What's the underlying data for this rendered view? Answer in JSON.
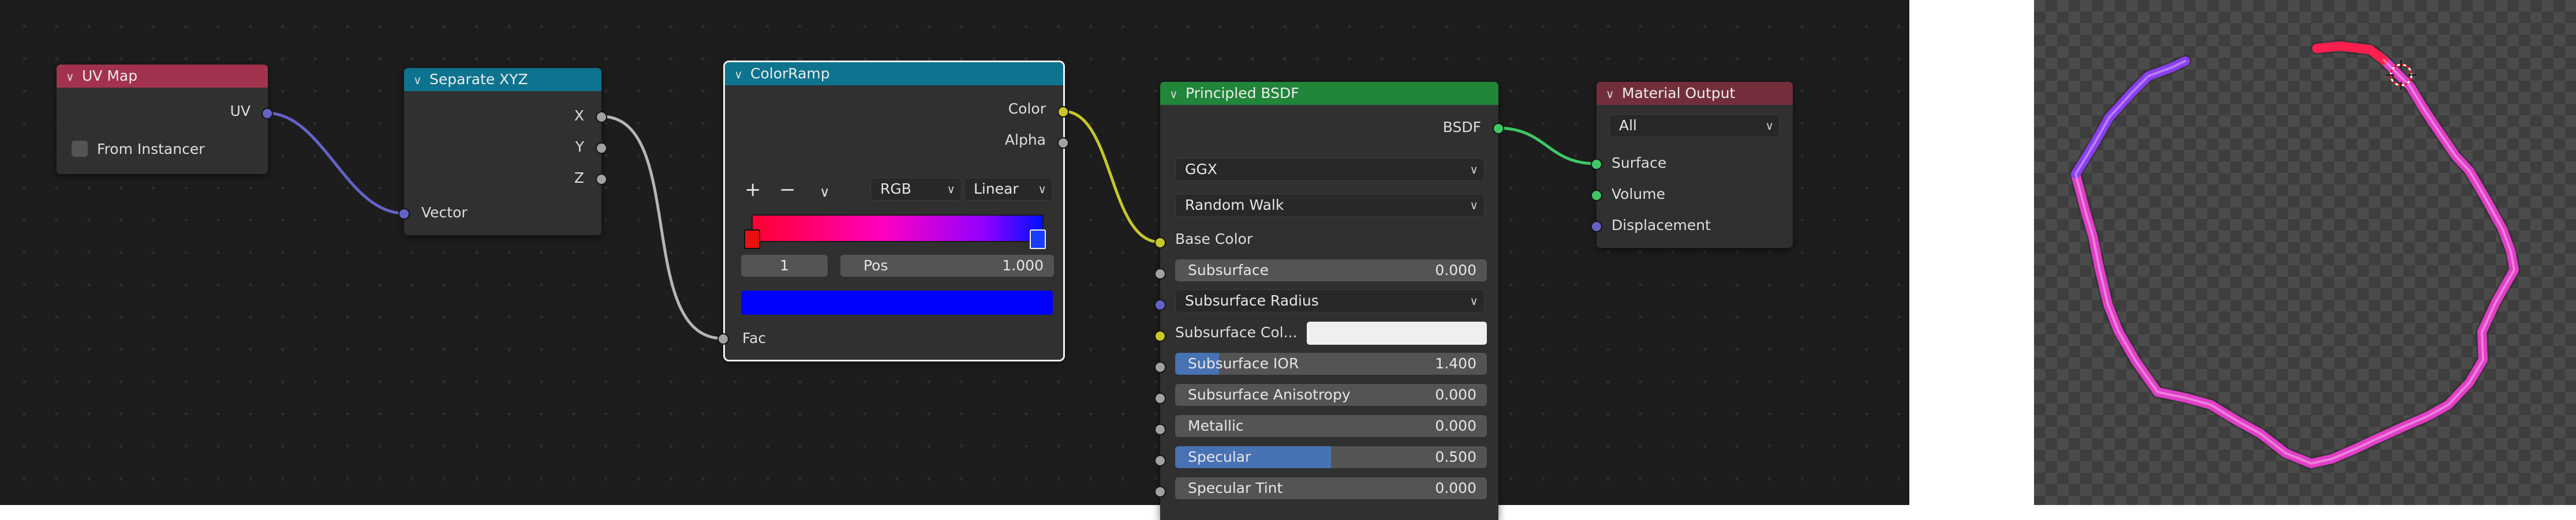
{
  "colors": {
    "uvmap_header": "#a3324f",
    "separate_header": "#0d738e",
    "colorramp_header": "#0d738e",
    "bsdf_header": "#21853a",
    "output_header": "#722f3b",
    "socket_vector": "#6363c7",
    "socket_color": "#c7c729",
    "socket_float": "#a1a1a1",
    "socket_shader": "#3fc766",
    "ramp_color_out": "#0000ff",
    "slider_fill": "#4772b3"
  },
  "nodes": {
    "uv_map": {
      "title": "UV Map",
      "output_uv": "UV",
      "from_instancer": "From Instancer"
    },
    "separate_xyz": {
      "title": "Separate XYZ",
      "out_x": "X",
      "out_y": "Y",
      "out_z": "Z",
      "in_vector": "Vector"
    },
    "color_ramp": {
      "title": "ColorRamp",
      "out_color": "Color",
      "out_alpha": "Alpha",
      "add": "+",
      "remove": "−",
      "menu": "∨",
      "color_mode": "RGB",
      "interpolation": "Linear",
      "stop_index": "1",
      "pos_label": "Pos",
      "pos_value": "1.000",
      "in_fac": "Fac"
    },
    "principled": {
      "title": "Principled BSDF",
      "out_bsdf": "BSDF",
      "distribution": "GGX",
      "subsurface_method": "Random Walk",
      "base_color": "Base Color",
      "subsurface": {
        "label": "Subsurface",
        "value": "0.000",
        "fill": 0
      },
      "subsurface_radius": "Subsurface Radius",
      "subsurface_color": "Subsurface Col...",
      "subsurface_ior": {
        "label": "Subsurface IOR",
        "value": "1.400",
        "fill": 0.14
      },
      "subsurface_anisotropy": {
        "label": "Subsurface Anisotropy",
        "value": "0.000",
        "fill": 0
      },
      "metallic": {
        "label": "Metallic",
        "value": "0.000",
        "fill": 0
      },
      "specular": {
        "label": "Specular",
        "value": "0.500",
        "fill": 0.5
      },
      "specular_tint": {
        "label": "Specular Tint",
        "value": "0.000",
        "fill": 0
      }
    },
    "material_output": {
      "title": "Material Output",
      "target": "All",
      "surface": "Surface",
      "volume": "Volume",
      "displacement": "Displacement"
    }
  },
  "viewport": {
    "stroke_start_color": "#ff1f6b",
    "stroke_mid_color": "#e83fd6",
    "stroke_end_color": "#7a3cf0"
  }
}
